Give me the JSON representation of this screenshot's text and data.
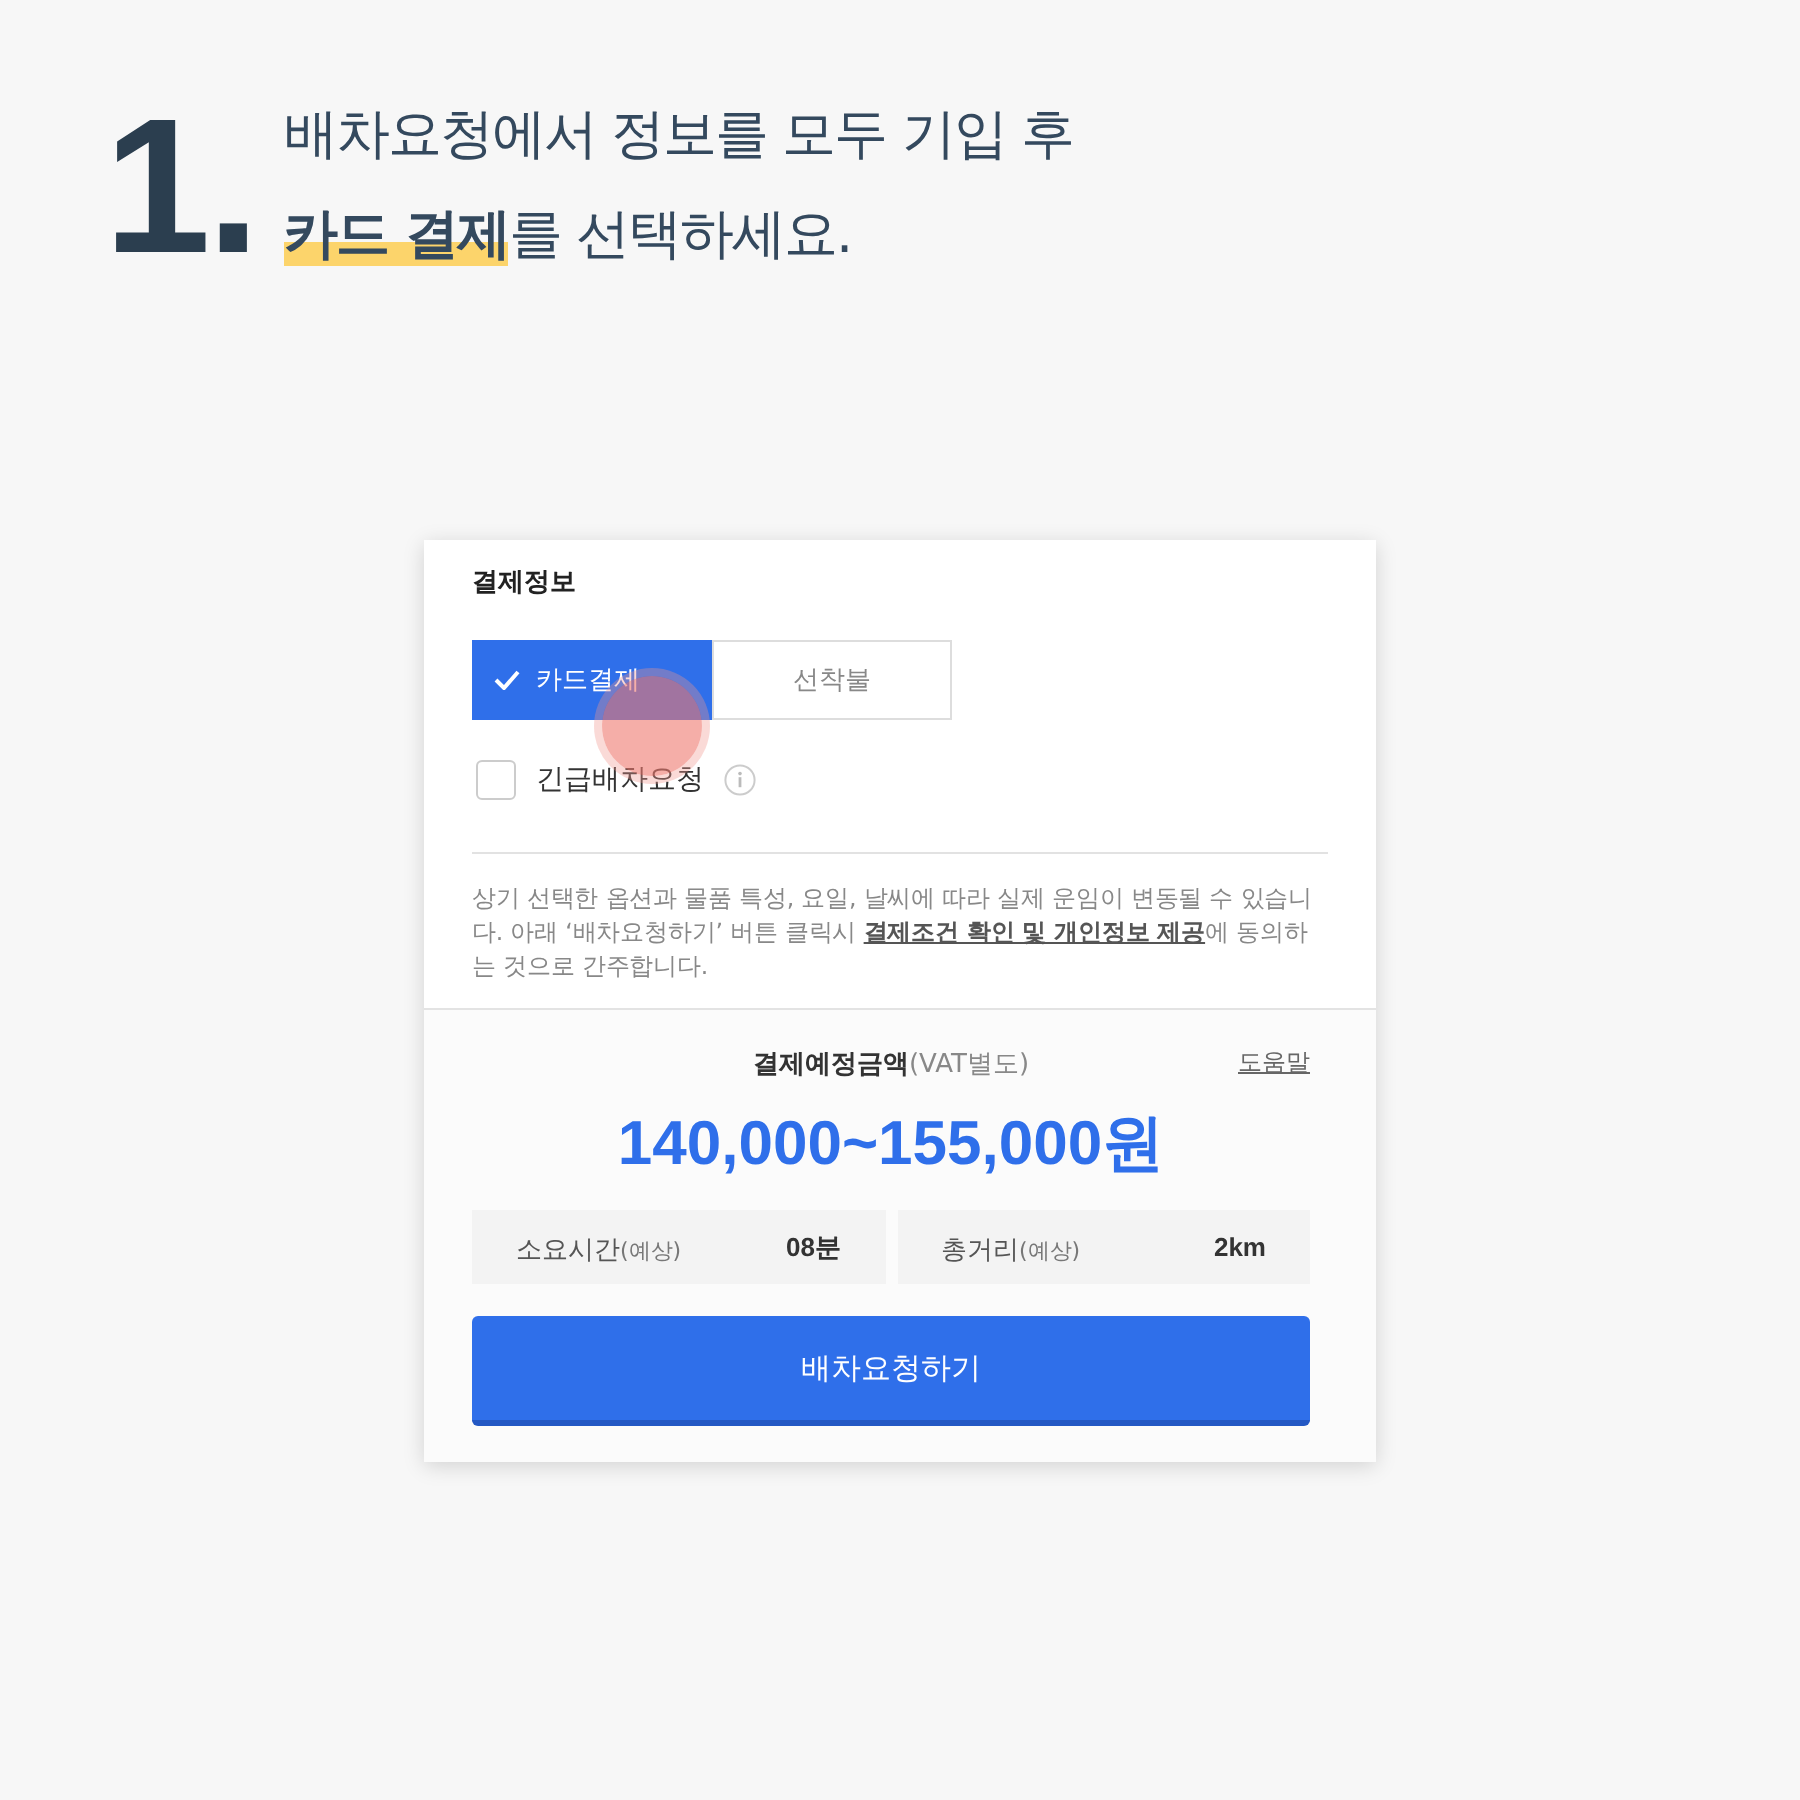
{
  "step": {
    "number": "1.",
    "lines": [
      "배차요청에서 정보를 모두 기입 후",
      "**카드 결제**를 선택하세요."
    ]
  },
  "card": {
    "section_title": "결제정보",
    "payment_options": [
      {
        "label": "카드결제",
        "selected": true
      },
      {
        "label": "선착불",
        "selected": false
      }
    ],
    "urgent": {
      "label": "긴급배차요청",
      "checked": false
    },
    "notice_parts": [
      "상기 선택한 옵션과 물품 특성, 요일, 날씨에 따라 실제 운임이 변동될 수 있습니다. 아래 ‘배차요청하기’ 버튼 클릭시 ",
      "결제조건 확인 및 개인정보 제공",
      "에 동의하는 것으로 간주합니다."
    ],
    "estimate_label": "결제예정금액",
    "estimate_note": "(VAT별도)",
    "help": "도움말",
    "amount": "140,000~155,000원",
    "stats": [
      {
        "label": "소요시간",
        "note": "(예상)",
        "value": "08분"
      },
      {
        "label": "총거리",
        "note": "(예상)",
        "value": "2km"
      }
    ],
    "submit": "배차요청하기"
  }
}
